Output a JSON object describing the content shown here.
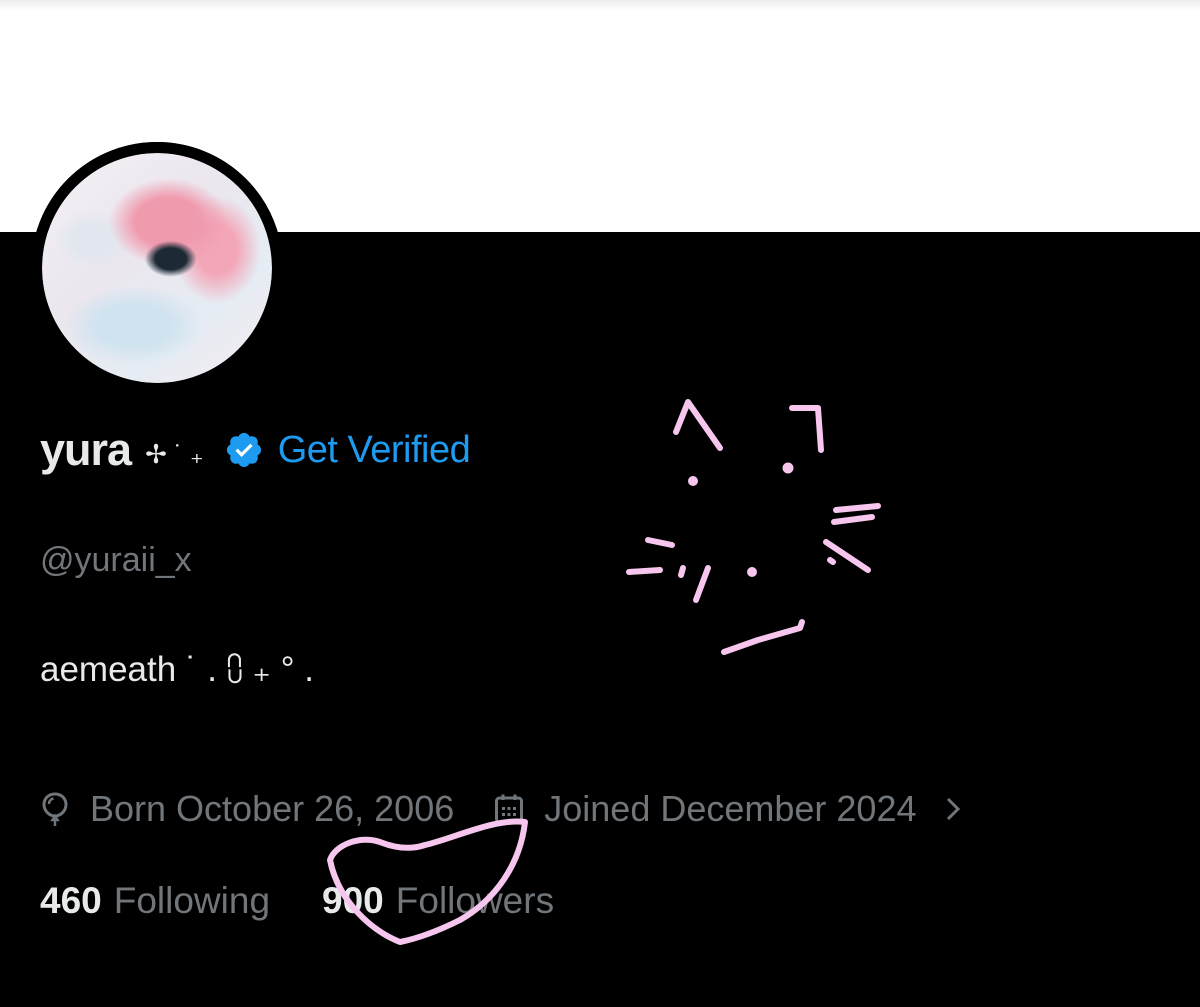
{
  "profile": {
    "display_name": "yura",
    "name_decoration": "✢ ˙ ₊",
    "get_verified_label": "Get Verified",
    "handle": "@yuraii_x",
    "bio": "aemeath ˙ . ⩇ ₊ ° ."
  },
  "meta": {
    "born": "Born October 26, 2006",
    "joined": "Joined December 2024"
  },
  "stats": {
    "following_count": "460",
    "following_label": "Following",
    "followers_count": "900",
    "followers_label": "Followers"
  },
  "icons": {
    "verified": "verified-badge-icon",
    "born": "balloon-icon",
    "joined": "calendar-icon",
    "more": "chevron-right-icon"
  },
  "colors": {
    "background": "#000000",
    "banner": "#ffffff",
    "primary_text": "#e7e9ea",
    "secondary_text": "#71767b",
    "accent": "#1d9bf0",
    "doodle": "#f7c6ef"
  }
}
